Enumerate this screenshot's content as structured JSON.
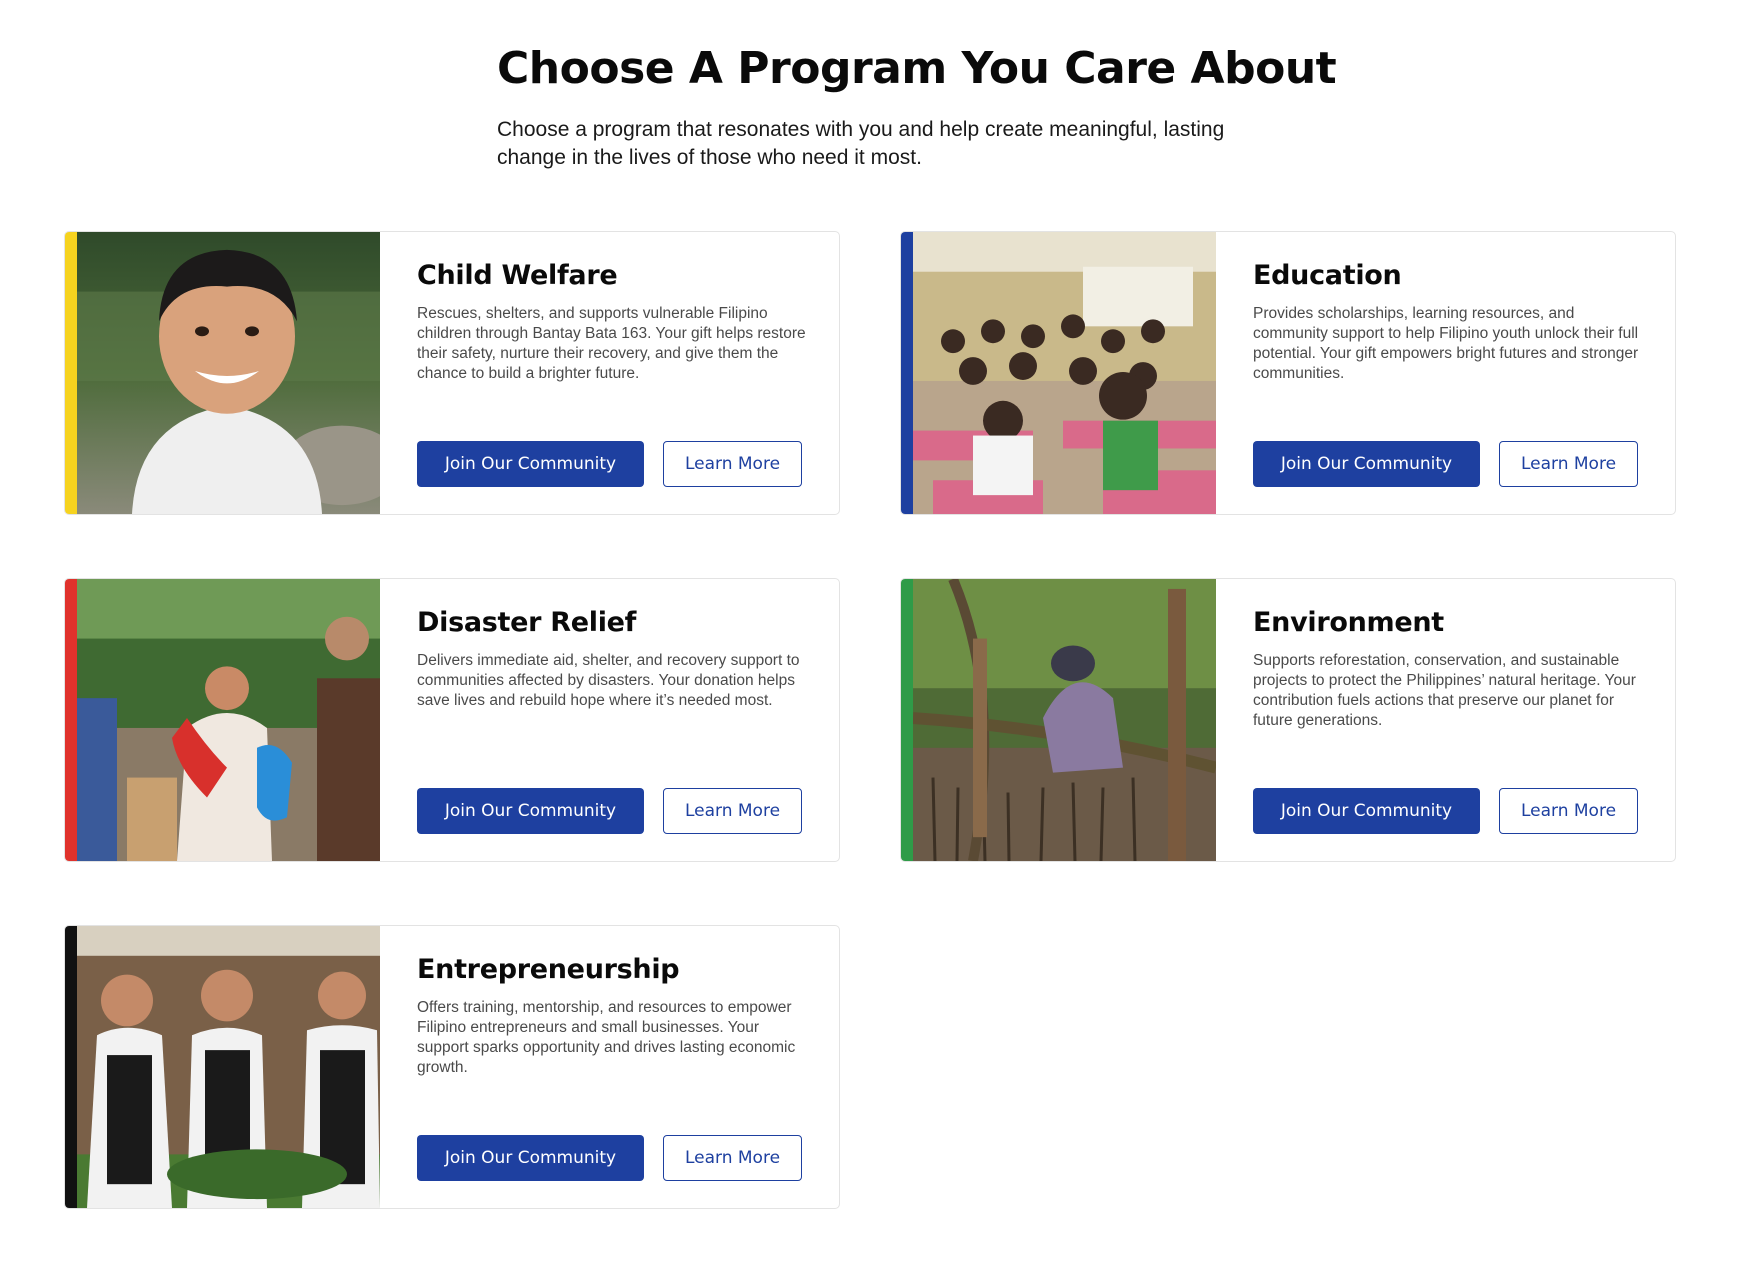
{
  "header": {
    "title": "Choose A Program You Care About",
    "subtitle": "Choose a program that resonates with you and help create meaningful, lasting change in the lives of those who need it most."
  },
  "programs": [
    {
      "title": "Child Welfare",
      "description": "Rescues, shelters, and supports vulnerable Filipino children through Bantay Bata 163. Your gift helps restore their safety, nurture their recovery, and give them the chance to build a brighter future.",
      "accent_color": "#f6d31f",
      "image": "smiling-child-photo",
      "primary_label": "Join Our Community",
      "secondary_label": "Learn More"
    },
    {
      "title": "Education",
      "description": "Provides scholarships, learning resources, and community support to help Filipino youth unlock their full potential. Your gift empowers bright futures and stronger communities.",
      "accent_color": "#1e40a0",
      "image": "classroom-students-photo",
      "primary_label": "Join Our Community",
      "secondary_label": "Learn More"
    },
    {
      "title": "Disaster Relief",
      "description": "Delivers immediate aid, shelter, and recovery support to communities affected by disasters. Your donation helps save lives and rebuild hope where it’s needed most.",
      "accent_color": "#e0322c",
      "image": "relief-distribution-photo",
      "primary_label": "Join Our Community",
      "secondary_label": "Learn More"
    },
    {
      "title": "Environment",
      "description": "Supports reforestation, conservation, and sustainable projects to protect the Philippines’ natural heritage. Your contribution fuels actions that preserve our planet for future generations.",
      "accent_color": "#2f9b48",
      "image": "mangrove-planting-photo",
      "primary_label": "Join Our Community",
      "secondary_label": "Learn More"
    },
    {
      "title": "Entrepreneurship",
      "description": "Offers training, mentorship, and resources to empower Filipino entrepreneurs and small businesses. Your support sparks opportunity and drives lasting economic growth.",
      "accent_color": "#111111",
      "image": "women-entrepreneurs-photo",
      "primary_label": "Join Our Community",
      "secondary_label": "Learn More"
    }
  ],
  "colors": {
    "primary_button": "#1e40a0",
    "button_text": "#ffffff",
    "card_border": "#e3e3e3"
  }
}
